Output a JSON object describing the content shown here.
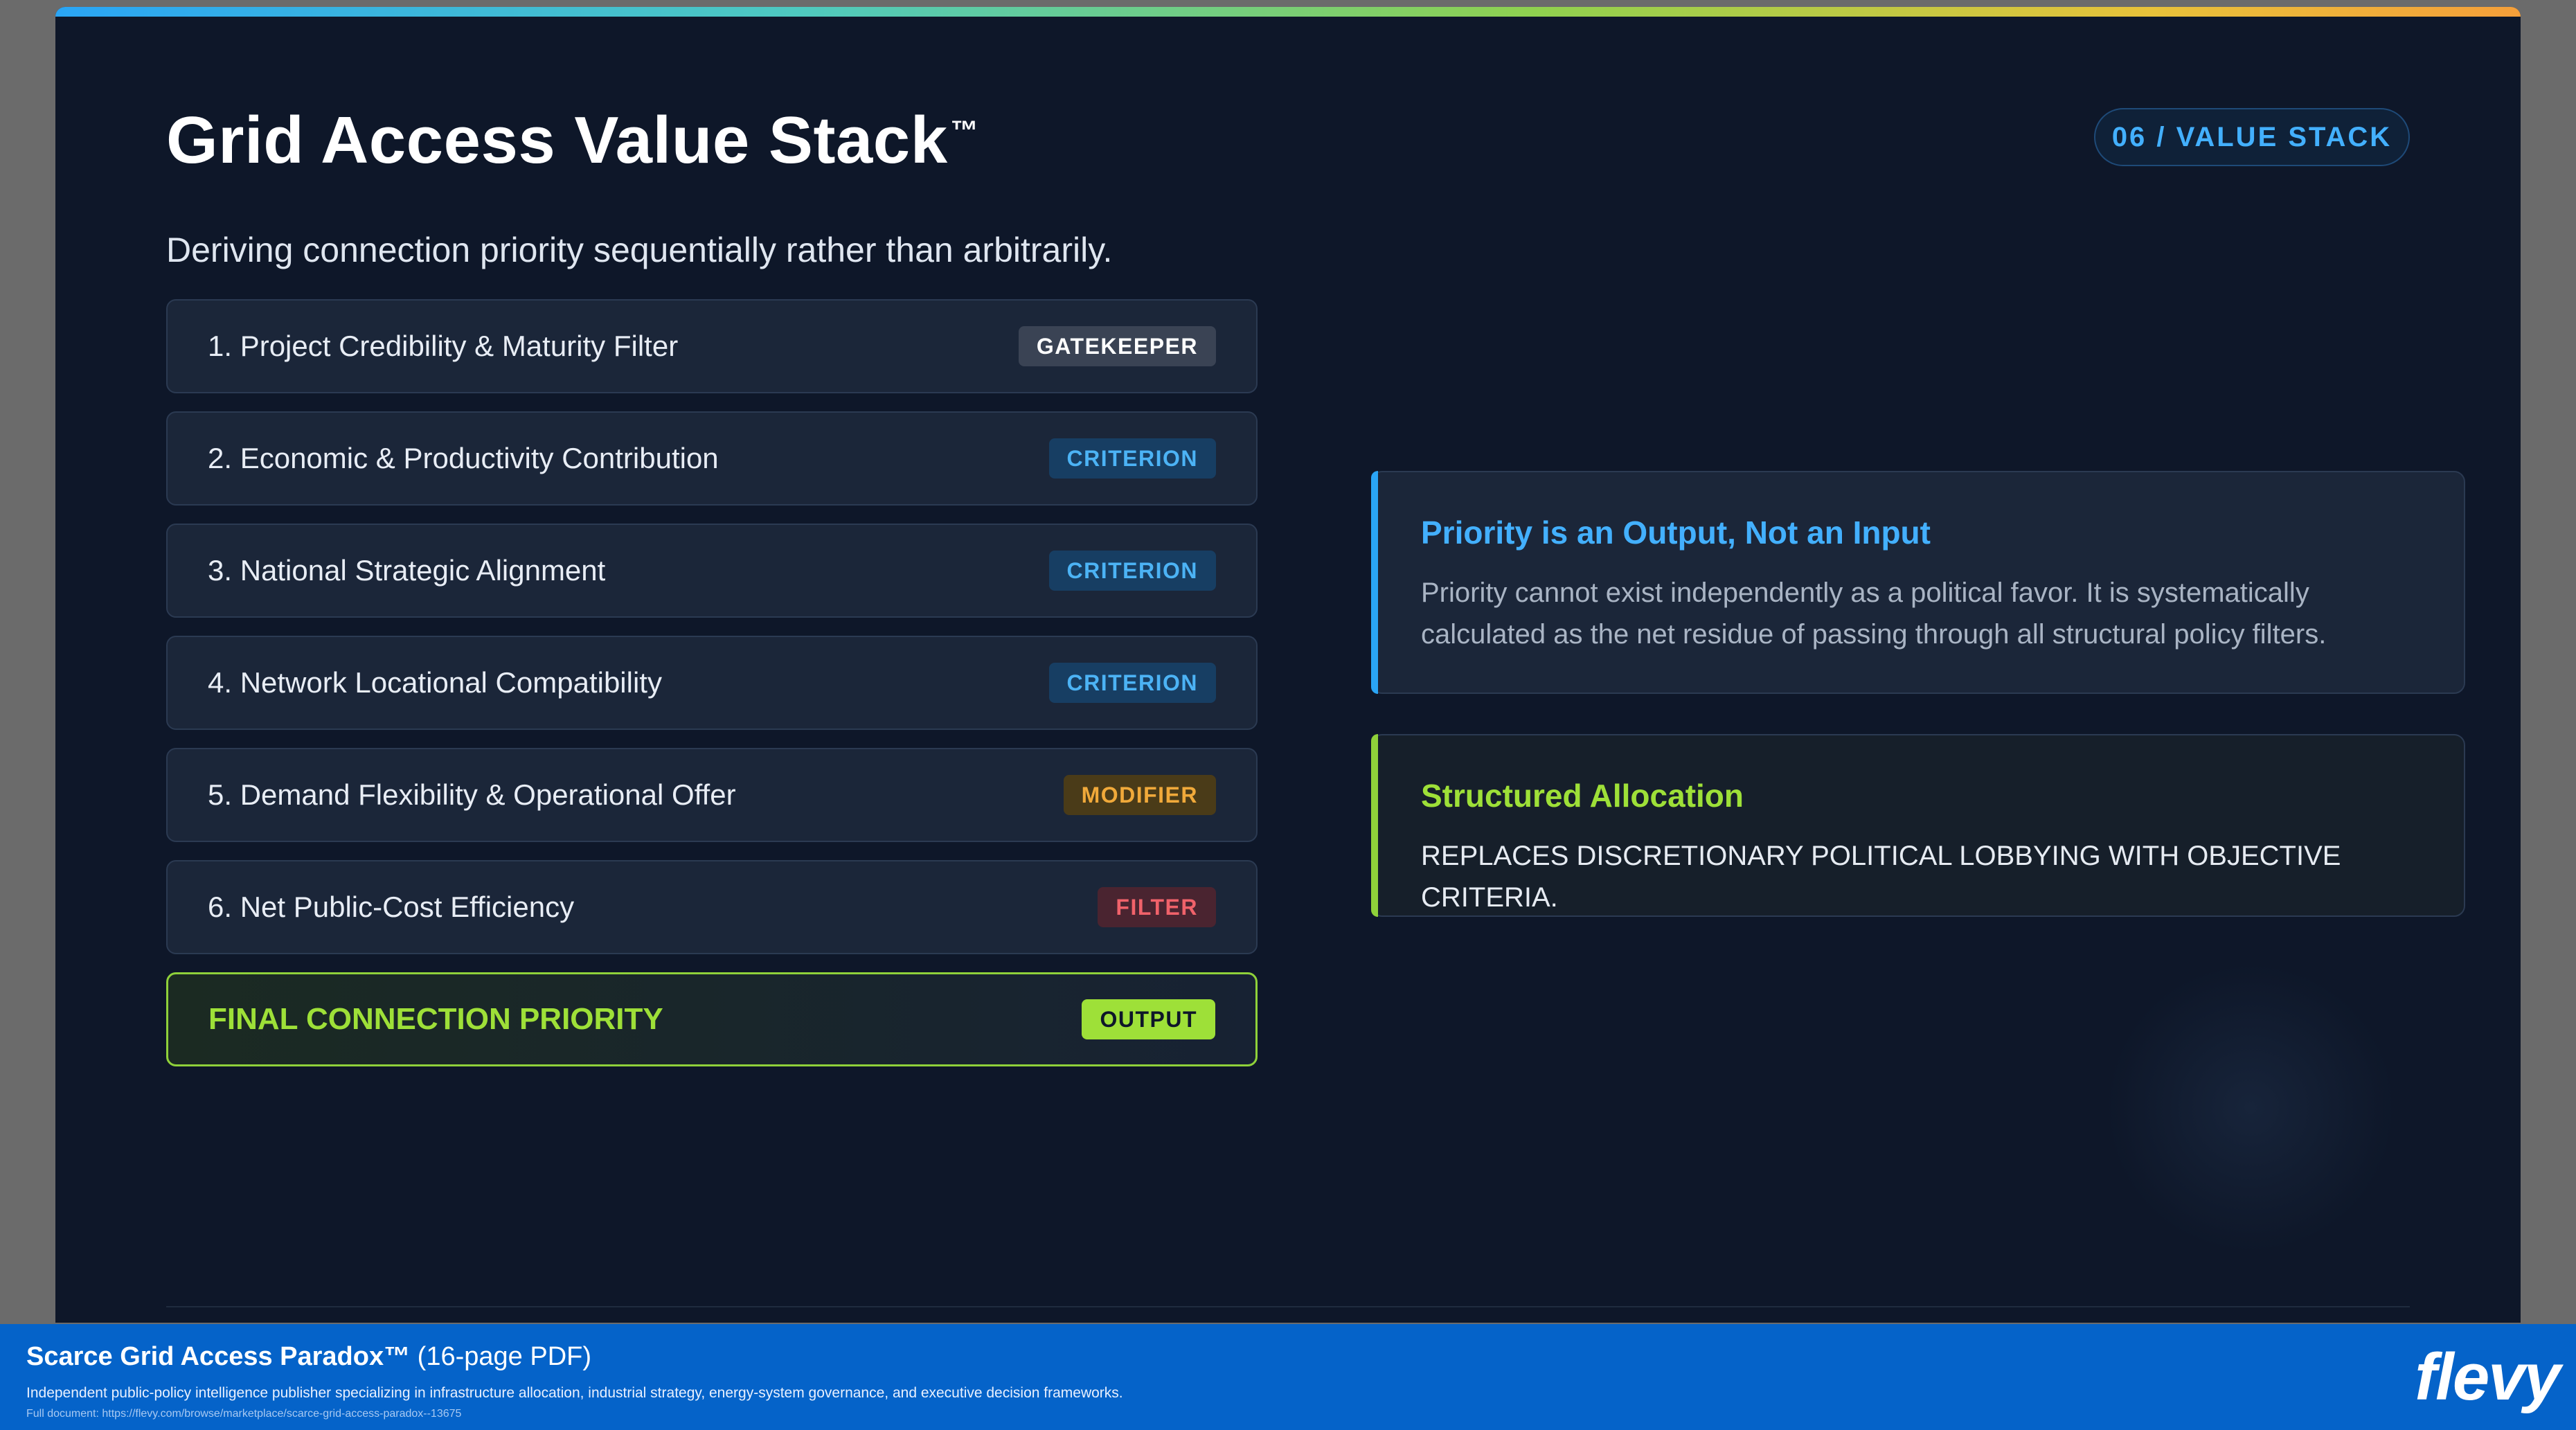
{
  "slide": {
    "title": "Grid Access Value Stack",
    "title_mark": "™",
    "section_pill": "06 / VALUE STACK",
    "subtitle": "Deriving connection priority sequentially rather than arbitrarily."
  },
  "stack": [
    {
      "label": "1. Project Credibility & Maturity Filter",
      "tag": "GATEKEEPER"
    },
    {
      "label": "2. Economic & Productivity Contribution",
      "tag": "CRITERION"
    },
    {
      "label": "3. National Strategic Alignment",
      "tag": "CRITERION"
    },
    {
      "label": "4. Network Locational Compatibility",
      "tag": "CRITERION"
    },
    {
      "label": "5. Demand Flexibility & Operational Offer",
      "tag": "MODIFIER"
    },
    {
      "label": "6. Net Public-Cost Efficiency",
      "tag": "FILTER"
    },
    {
      "label": "FINAL CONNECTION PRIORITY",
      "tag": "OUTPUT"
    }
  ],
  "cards": {
    "priority": {
      "title": "Priority is an Output, Not an Input",
      "body": "Priority cannot exist independently as a political favor. It is systematically calculated as the net residue of passing through all structural policy filters."
    },
    "allocation": {
      "title": "Structured Allocation",
      "body": "REPLACES DISCRETIONARY POLITICAL LOBBYING WITH OBJECTIVE CRITERIA."
    }
  },
  "footer": {
    "title": "Scarce Grid Access Paradox™",
    "title_suffix": " (16-page PDF)",
    "description": "Independent public-policy intelligence publisher specializing in infrastructure allocation, industrial strategy, energy-system governance, and executive decision frameworks.",
    "link": "Full document: https://flevy.com/browse/marketplace/scarce-grid-access-paradox--13675",
    "logo": "flevy"
  },
  "colors": {
    "background": "#0e1729",
    "accent_blue": "#43b0ff",
    "accent_green": "#9ee038",
    "modifier": "#f0a93a",
    "filter": "#f0626a",
    "footer": "#0563c9"
  }
}
